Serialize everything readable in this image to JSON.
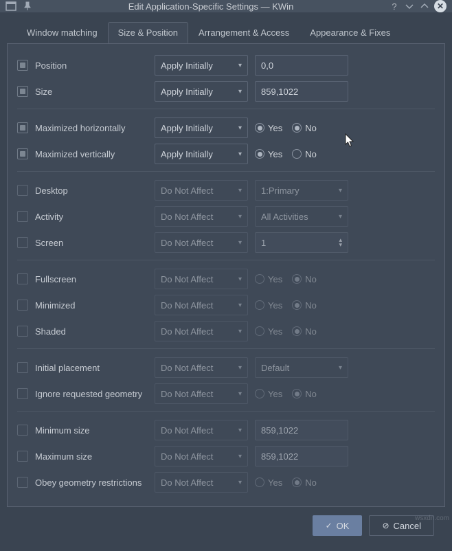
{
  "titlebar": {
    "title": "Edit Application-Specific Settings — KWin"
  },
  "tabs": {
    "t0": "Window matching",
    "t1": "Size & Position",
    "t2": "Arrangement & Access",
    "t3": "Appearance & Fixes"
  },
  "rules": {
    "apply_initially": "Apply Initially",
    "do_not_affect": "Do Not Affect"
  },
  "labels": {
    "position": "Position",
    "size": "Size",
    "max_h": "Maximized horizontally",
    "max_v": "Maximized vertically",
    "desktop": "Desktop",
    "activity": "Activity",
    "screen": "Screen",
    "fullscreen": "Fullscreen",
    "minimized": "Minimized",
    "shaded": "Shaded",
    "initial_placement": "Initial placement",
    "ignore_geom": "Ignore requested geometry",
    "min_size": "Minimum size",
    "max_size": "Maximum size",
    "obey_geom": "Obey geometry restrictions",
    "yes": "Yes",
    "no": "No"
  },
  "values": {
    "position": "0,0",
    "size": "859,1022",
    "desktop": "1:Primary",
    "activity": "All Activities",
    "screen": "1",
    "initial_placement": "Default",
    "min_size": "859,1022",
    "max_size": "859,1022"
  },
  "footer": {
    "ok": "OK",
    "cancel": "Cancel"
  },
  "watermark": "wsxdn.com"
}
